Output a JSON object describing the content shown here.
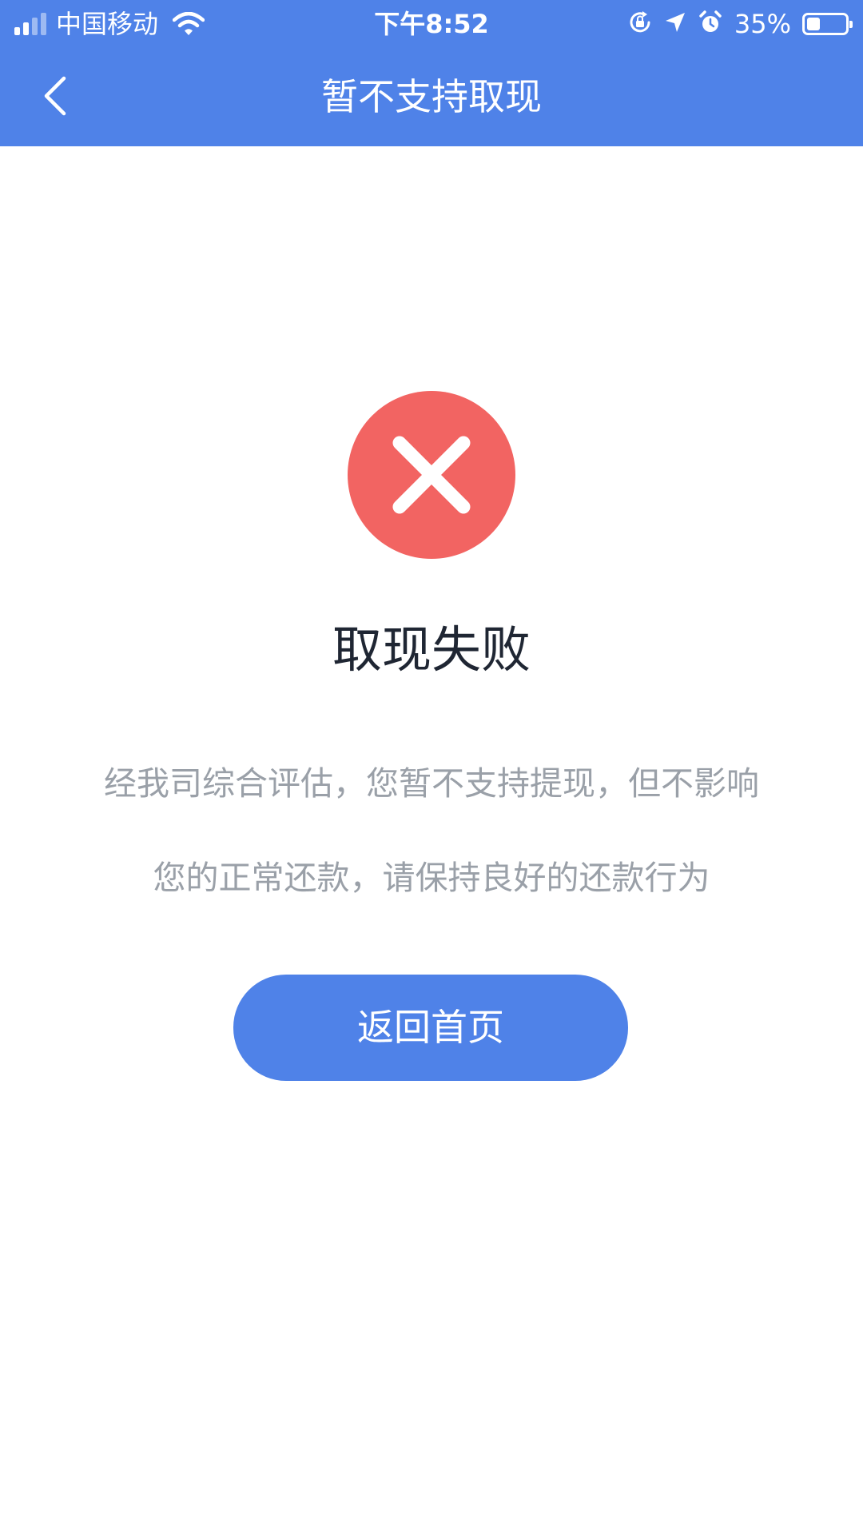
{
  "status_bar": {
    "carrier": "中国移动",
    "time": "下午8:52",
    "battery_percent_label": "35%",
    "battery_level": 0.35,
    "icons": [
      "signal-icon",
      "wifi-icon",
      "rotation-lock-icon",
      "location-arrow-icon",
      "alarm-icon",
      "battery-icon"
    ]
  },
  "navbar": {
    "back_icon": "chevron-left-icon",
    "title": "暂不支持取现"
  },
  "result": {
    "icon": "error-x-icon",
    "icon_color": "#f26462",
    "title": "取现失败",
    "description_lines": [
      "经我司综合评估，您暂不支持提现，但不影响",
      "您的正常还款，请保持良好的还款行为"
    ]
  },
  "actions": {
    "home_button_label": "返回首页"
  },
  "colors": {
    "brand_blue": "#4f82e8",
    "title_text": "#1f2633",
    "muted_text": "#9aa0a8"
  }
}
